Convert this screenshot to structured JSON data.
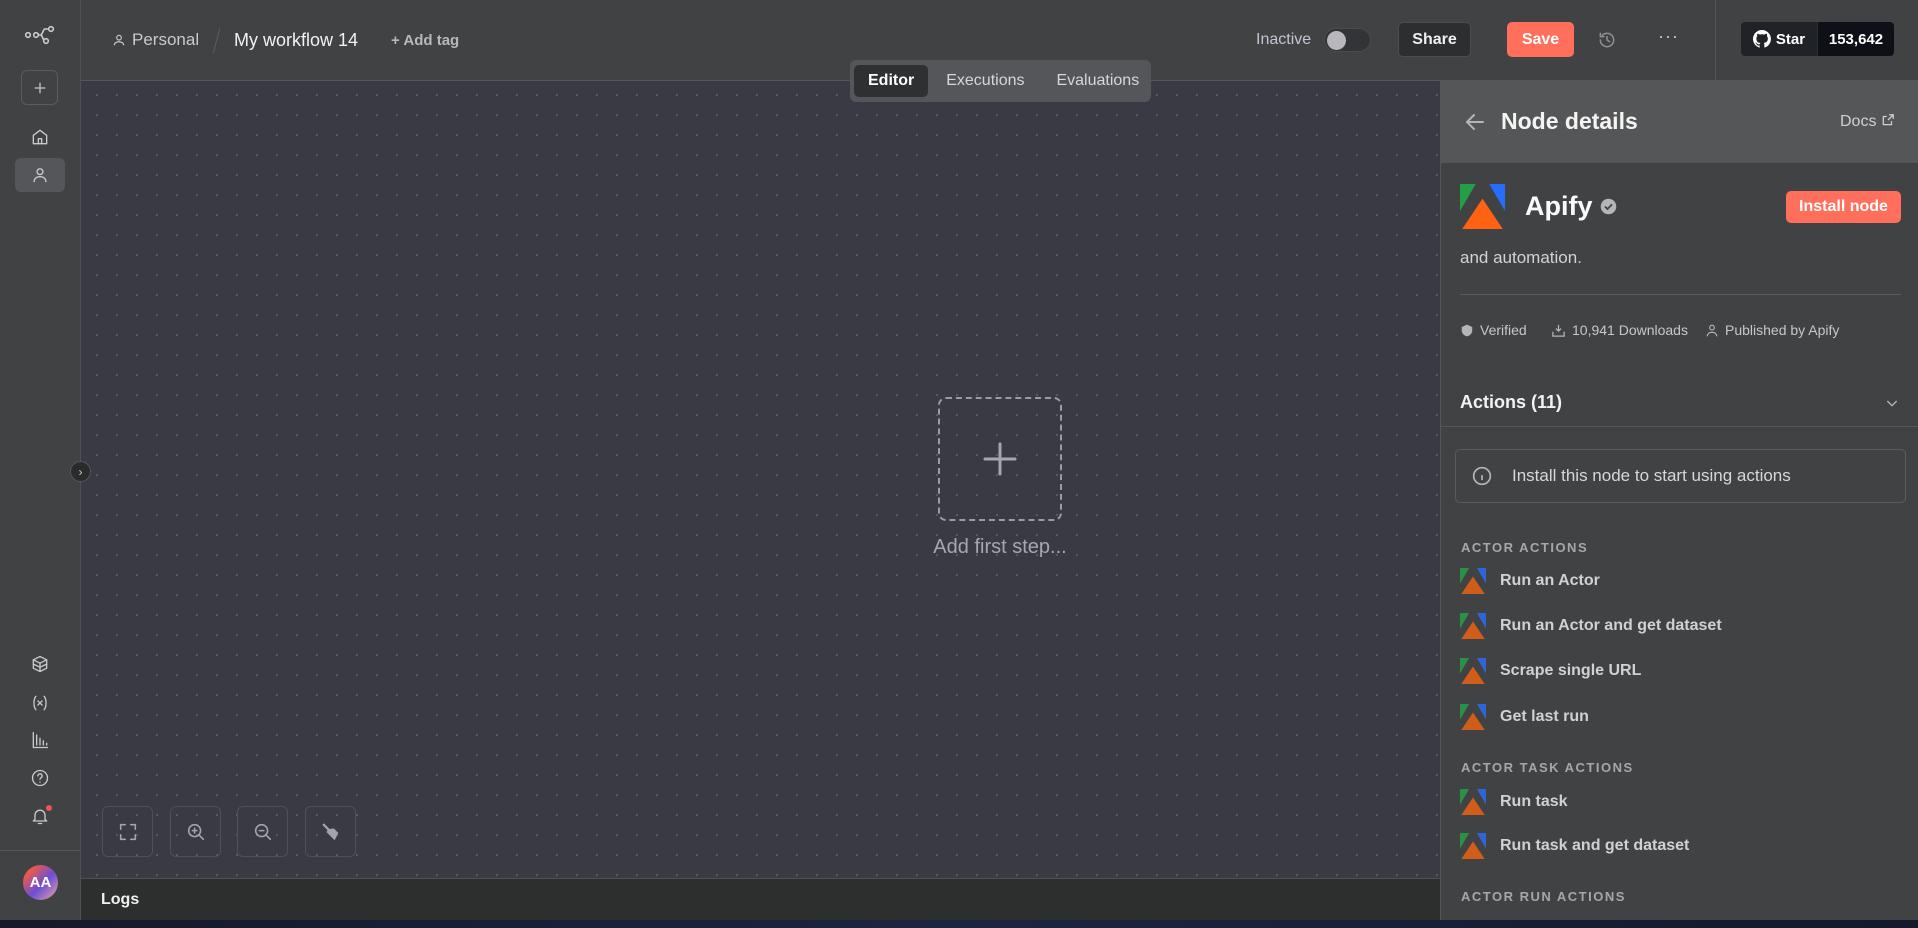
{
  "header": {
    "project": "Personal",
    "workflow_name": "My workflow 14",
    "add_tag": "+ Add tag",
    "status": "Inactive",
    "share": "Share",
    "save": "Save",
    "github_star": "Star",
    "github_count": "153,642"
  },
  "tabs": [
    {
      "label": "Editor",
      "active": true
    },
    {
      "label": "Executions"
    },
    {
      "label": "Evaluations"
    }
  ],
  "canvas": {
    "add_first_step": "Add first step..."
  },
  "logs": {
    "label": "Logs"
  },
  "user": {
    "initials": "AA"
  },
  "panel": {
    "title": "Node details",
    "docs": "Docs",
    "node_name": "Apify",
    "install": "Install node",
    "description": "and automation.",
    "verified": "Verified",
    "downloads": "10,941 Downloads",
    "publisher": "Published by Apify",
    "actions_header": "Actions (11)",
    "notice": "Install this node to start using actions",
    "sections": [
      {
        "title": "ACTOR ACTIONS",
        "items": [
          "Run an Actor",
          "Run an Actor and get dataset",
          "Scrape single URL",
          "Get last run"
        ]
      },
      {
        "title": "ACTOR TASK ACTIONS",
        "items": [
          "Run task",
          "Run task and get dataset"
        ]
      },
      {
        "title": "ACTOR RUN ACTIONS",
        "items": []
      }
    ]
  },
  "colors": {
    "accent": "#ff6f5c",
    "canvas": "#393a44",
    "panel": "#414244"
  }
}
